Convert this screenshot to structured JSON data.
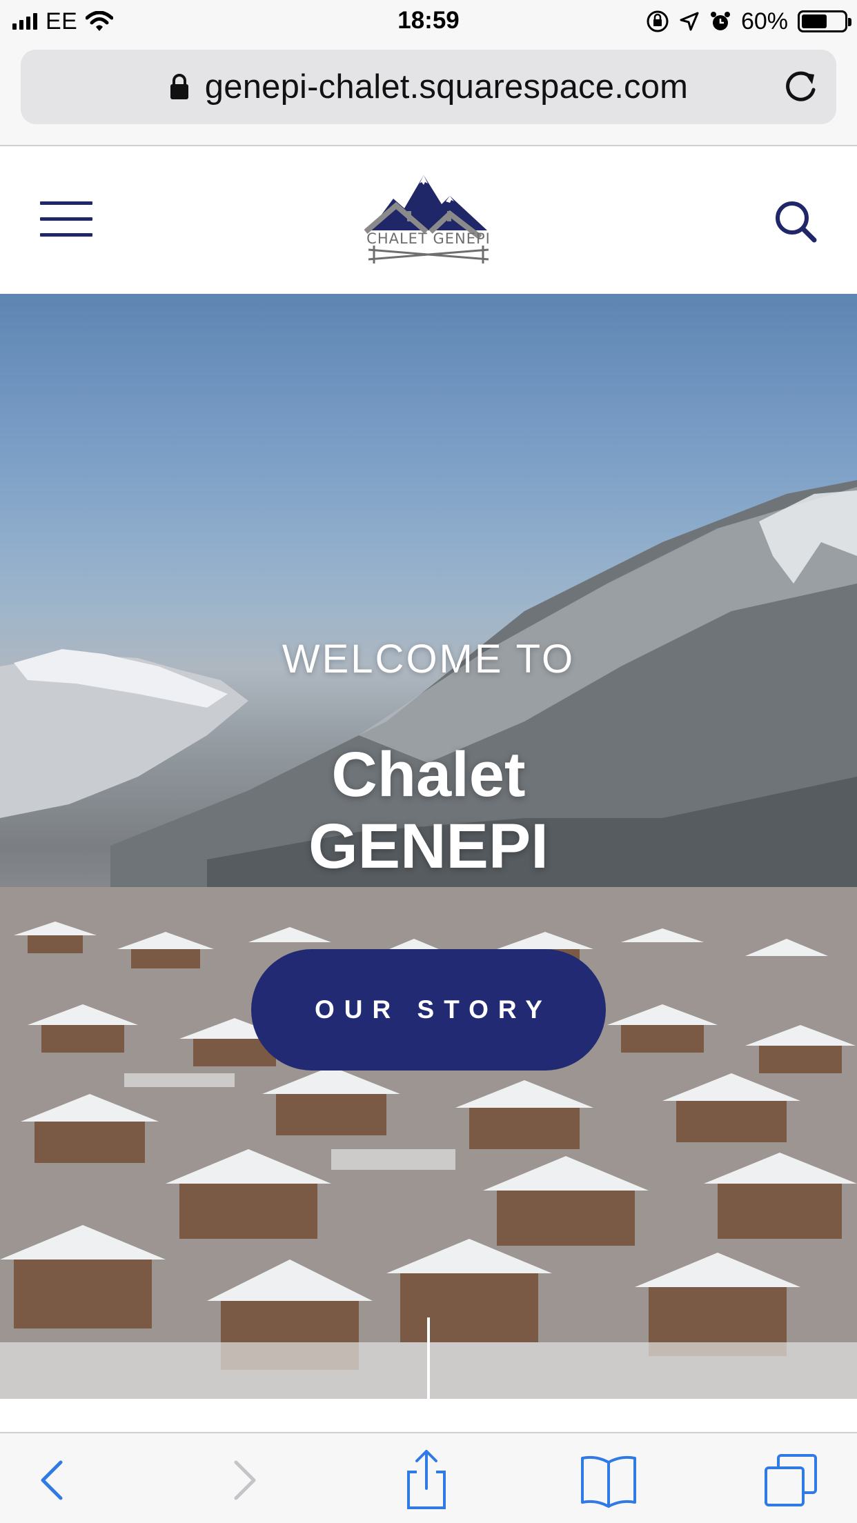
{
  "status_bar": {
    "carrier": "EE",
    "time": "18:59",
    "battery_percent": "60%",
    "battery_level": 0.6
  },
  "browser": {
    "url": "genepi-chalet.squarespace.com"
  },
  "site_header": {
    "logo_text": "CHALET GENEPI"
  },
  "hero": {
    "welcome": "WELCOME TO",
    "title_line1": "Chalet",
    "title_line2": "GENEPI",
    "cta_label": "OUR STORY"
  },
  "colors": {
    "brand_navy": "#212a72",
    "ios_blue": "#2f7ae5"
  },
  "icons": [
    "wifi-icon",
    "orientation-lock-icon",
    "location-icon",
    "alarm-icon",
    "lock-icon",
    "reload-icon",
    "hamburger-menu-icon",
    "search-icon",
    "back-icon",
    "forward-icon",
    "share-icon",
    "bookmarks-icon",
    "tabs-icon"
  ]
}
